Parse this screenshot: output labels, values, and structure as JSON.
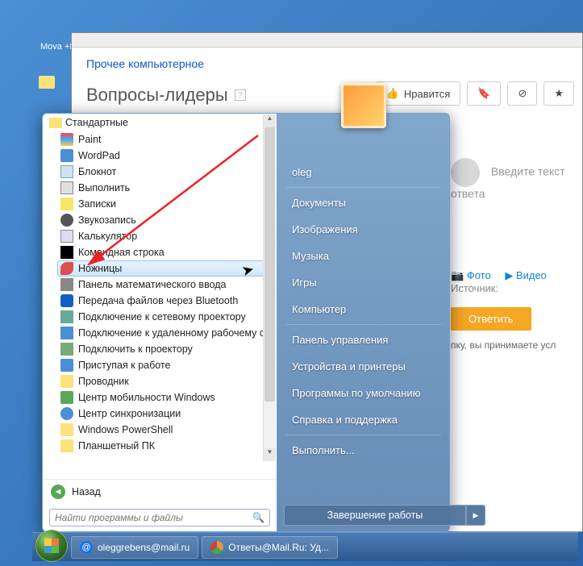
{
  "desktop_icon_label": "Mova\n+Po",
  "browser": {
    "breadcrumb": "Прочее компьютерное",
    "page_title": "Вопросы-лидеры",
    "like_btn": "Нравится",
    "answer_placeholder": "Введите текст ответа",
    "photo_label": "Фото",
    "video_label": "Видео",
    "source_label": "Источник:",
    "submit_label": "Ответить",
    "accept_text": "пку, вы принимаете усл"
  },
  "start_menu": {
    "folder": "Стандартные",
    "programs": [
      {
        "label": "Paint",
        "ico": "ico-paint"
      },
      {
        "label": "WordPad",
        "ico": "ico-wordpad"
      },
      {
        "label": "Блокнот",
        "ico": "ico-notepad"
      },
      {
        "label": "Выполнить",
        "ico": "ico-run"
      },
      {
        "label": "Записки",
        "ico": "ico-notes"
      },
      {
        "label": "Звукозапись",
        "ico": "ico-sound"
      },
      {
        "label": "Калькулятор",
        "ico": "ico-calc"
      },
      {
        "label": "Командная строка",
        "ico": "ico-cmd"
      },
      {
        "label": "Ножницы",
        "ico": "ico-snip",
        "highlighted": true
      },
      {
        "label": "Панель математического ввода",
        "ico": "ico-math"
      },
      {
        "label": "Передача файлов через Bluetooth",
        "ico": "ico-bt"
      },
      {
        "label": "Подключение к сетевому проектору",
        "ico": "ico-proj"
      },
      {
        "label": "Подключение к удаленному рабочему стол",
        "ico": "ico-rdp"
      },
      {
        "label": "Подключить к проектору",
        "ico": "ico-proj2"
      },
      {
        "label": "Приступая к работе",
        "ico": "ico-start"
      },
      {
        "label": "Проводник",
        "ico": "ico-explorer"
      },
      {
        "label": "Центр мобильности Windows",
        "ico": "ico-mobility"
      },
      {
        "label": "Центр синхронизации",
        "ico": "ico-sync"
      },
      {
        "label": "Windows PowerShell",
        "ico": "ico-folder"
      },
      {
        "label": "Планшетный ПК",
        "ico": "ico-folder"
      }
    ],
    "back": "Назад",
    "search_placeholder": "Найти программы и файлы",
    "right": [
      "oleg",
      "Документы",
      "Изображения",
      "Музыка",
      "Игры",
      "Компьютер",
      "Панель управления",
      "Устройства и принтеры",
      "Программы по умолчанию",
      "Справка и поддержка",
      "Выполнить..."
    ],
    "shutdown": "Завершение работы"
  },
  "taskbar": {
    "items": [
      {
        "label": "oleggrebens@mail.ru",
        "ico": "at"
      },
      {
        "label": "Ответы@Mail.Ru: Уд...",
        "ico": "chrome"
      }
    ]
  }
}
